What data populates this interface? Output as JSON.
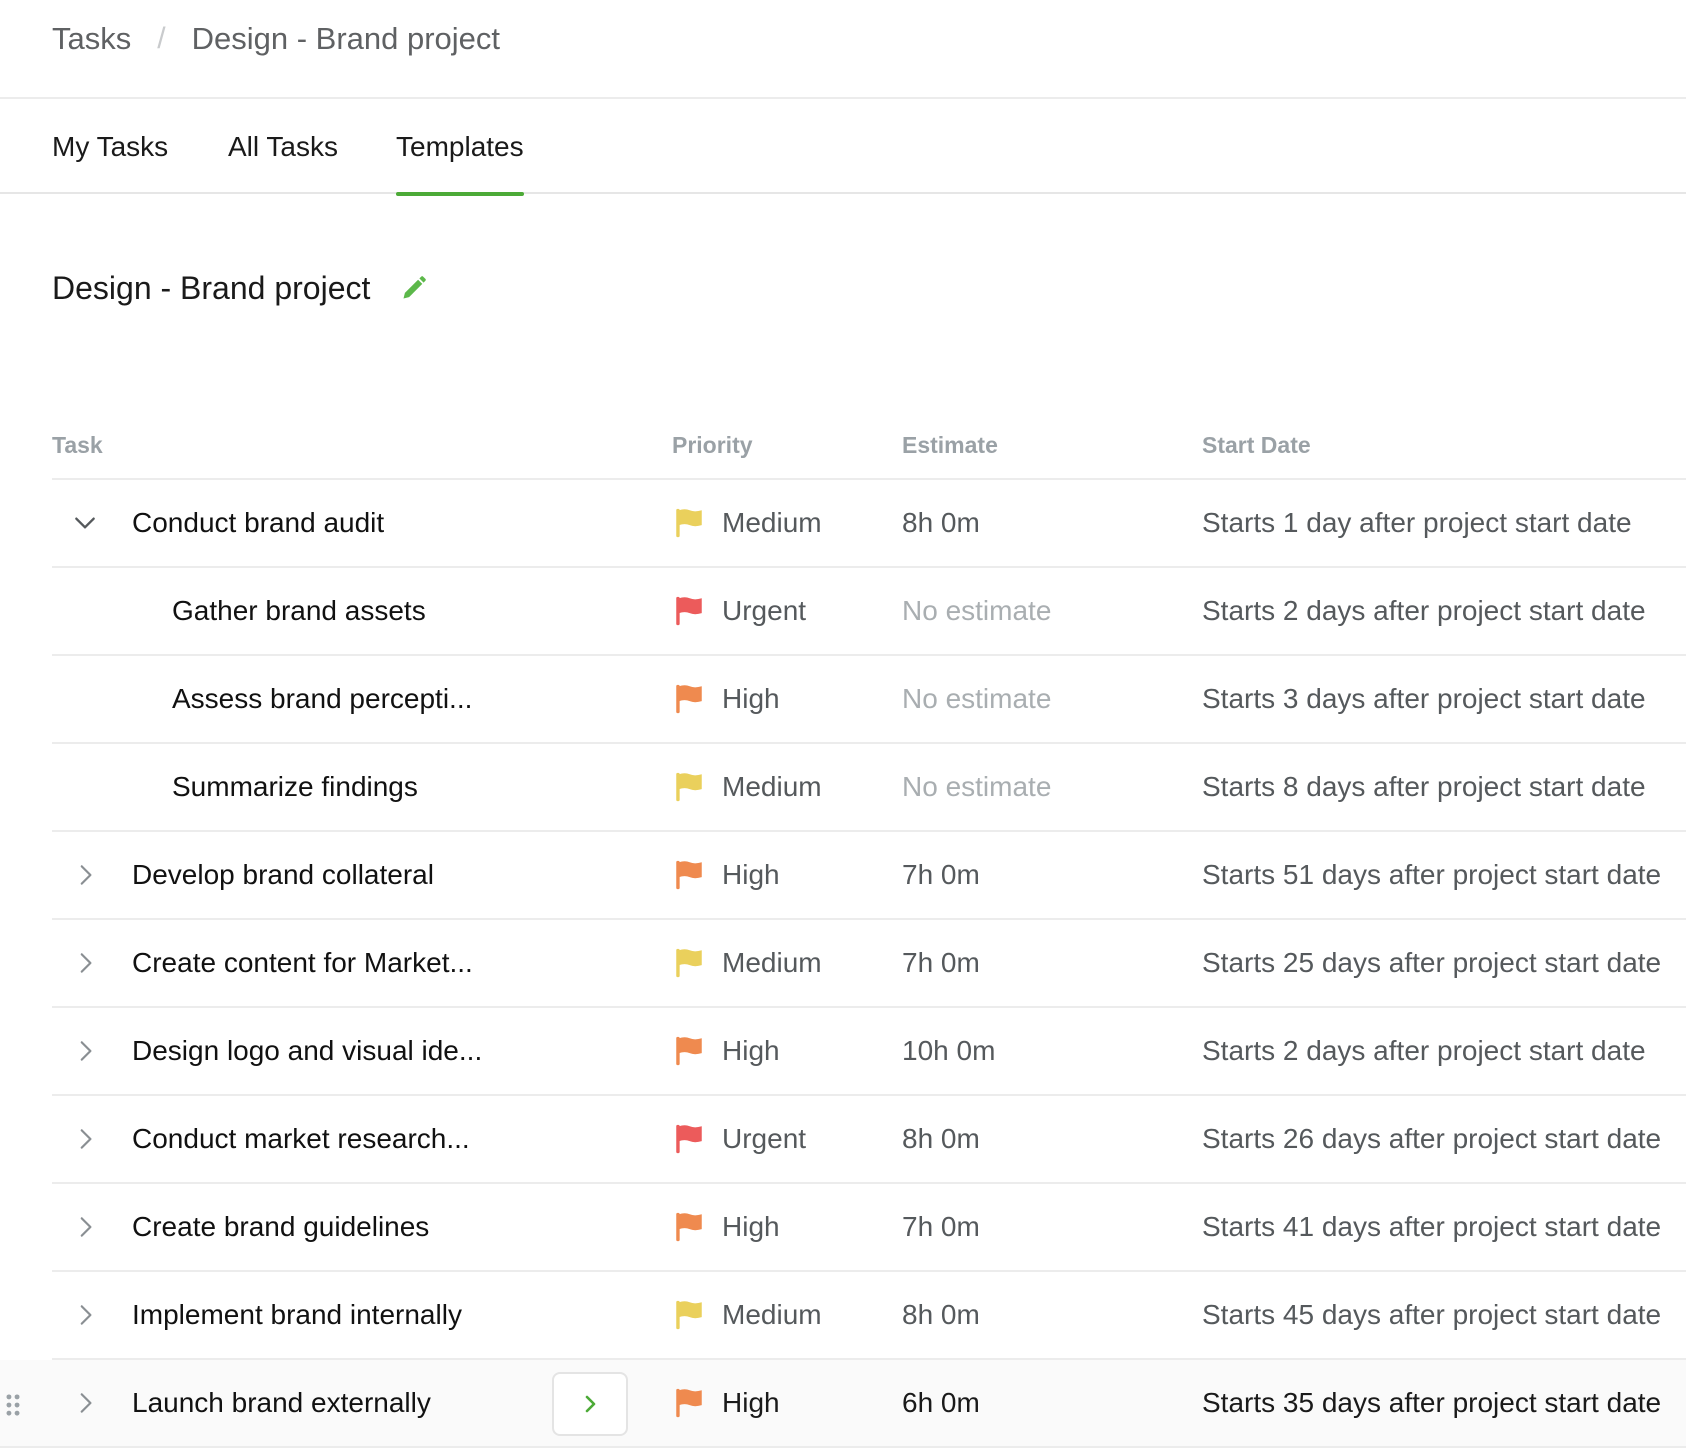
{
  "breadcrumb": {
    "root": "Tasks",
    "separator": "/",
    "current": "Design - Brand project"
  },
  "tabs": [
    {
      "label": "My Tasks",
      "active": false
    },
    {
      "label": "All Tasks",
      "active": false
    },
    {
      "label": "Templates",
      "active": true
    }
  ],
  "project": {
    "title": "Design - Brand project",
    "edit_icon": "pencil-icon"
  },
  "columns": {
    "task": "Task",
    "priority": "Priority",
    "estimate": "Estimate",
    "start_date": "Start Date"
  },
  "colors": {
    "accent": "#4caa37",
    "urgent": "#ec5b5b",
    "high": "#ef8a4f",
    "medium": "#ead05c"
  },
  "rows": [
    {
      "name": "Conduct brand audit",
      "level": 0,
      "expander": "chevron-down-icon",
      "priority": "Medium",
      "estimate": "8h 0m",
      "start": "Starts 1 day after project start date"
    },
    {
      "name": "Gather brand assets",
      "level": 1,
      "expander": "",
      "priority": "Urgent",
      "estimate": "No estimate",
      "start": "Starts 2 days after project start date"
    },
    {
      "name": "Assess brand percepti...",
      "level": 1,
      "expander": "",
      "priority": "High",
      "estimate": "No estimate",
      "start": "Starts 3 days after project start date"
    },
    {
      "name": "Summarize findings",
      "level": 1,
      "expander": "",
      "priority": "Medium",
      "estimate": "No estimate",
      "start": "Starts 8 days after project start date"
    },
    {
      "name": "Develop brand collateral",
      "level": 0,
      "expander": "chevron-right-icon",
      "priority": "High",
      "estimate": "7h 0m",
      "start": "Starts 51 days after project start date"
    },
    {
      "name": "Create content for Market...",
      "level": 0,
      "expander": "chevron-right-icon",
      "priority": "Medium",
      "estimate": "7h 0m",
      "start": "Starts 25 days after project start date"
    },
    {
      "name": "Design logo and visual ide...",
      "level": 0,
      "expander": "chevron-right-icon",
      "priority": "High",
      "estimate": "10h 0m",
      "start": "Starts 2 days after project start date"
    },
    {
      "name": "Conduct market research...",
      "level": 0,
      "expander": "chevron-right-icon",
      "priority": "Urgent",
      "estimate": "8h 0m",
      "start": "Starts 26 days after project start date"
    },
    {
      "name": "Create brand guidelines",
      "level": 0,
      "expander": "chevron-right-icon",
      "priority": "High",
      "estimate": "7h 0m",
      "start": "Starts 41 days after project start date"
    },
    {
      "name": "Implement brand internally",
      "level": 0,
      "expander": "chevron-right-icon",
      "priority": "Medium",
      "estimate": "8h 0m",
      "start": "Starts 45 days after project start date"
    },
    {
      "name": "Launch brand externally",
      "level": 0,
      "expander": "chevron-right-icon",
      "priority": "High",
      "estimate": "6h 0m",
      "start": "Starts 35 days after project start date",
      "hovered": true
    }
  ]
}
